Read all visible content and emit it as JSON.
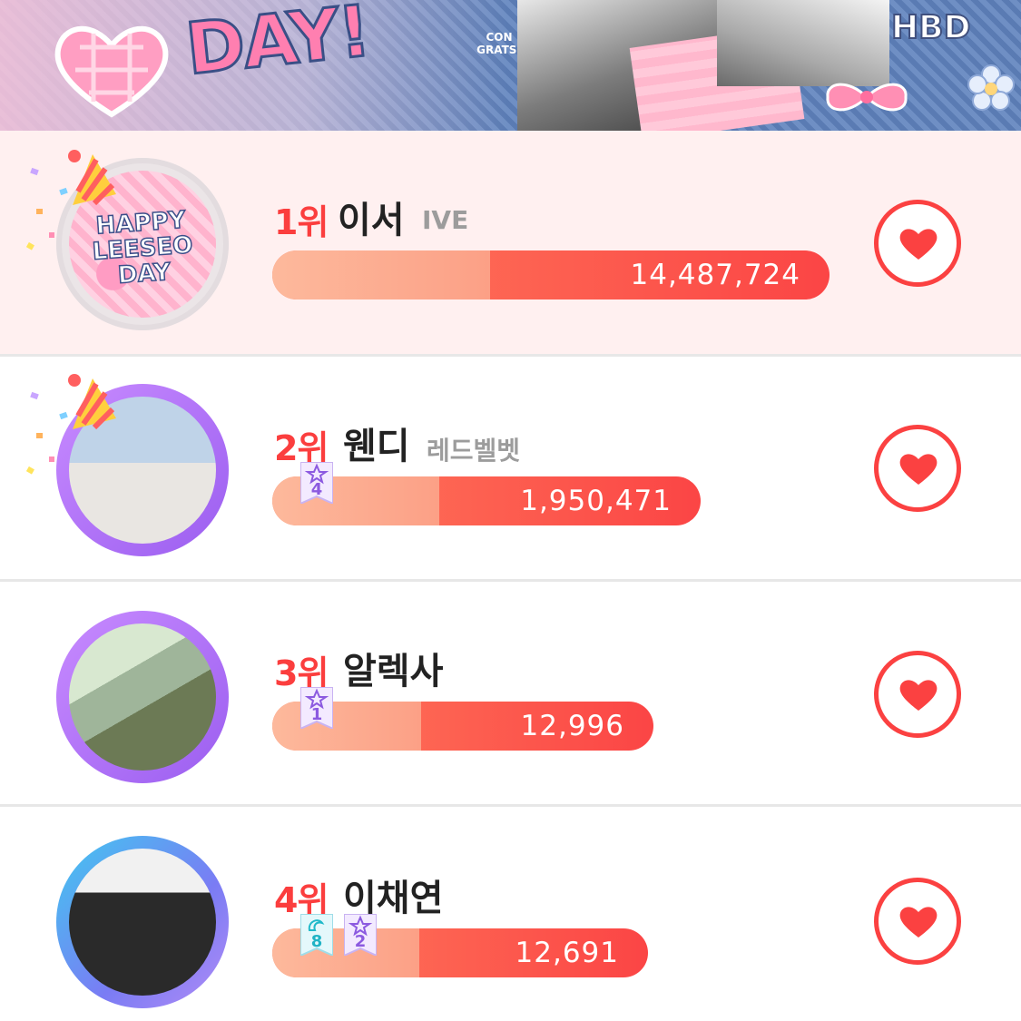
{
  "banner": {
    "day_text": "DAY!",
    "congrats_text": "CON GRATS!",
    "hbd_text": "HBD"
  },
  "rankings": [
    {
      "rank": "1위",
      "name": "이서",
      "group": "IVE",
      "votes": "14,487,724",
      "fill_fraction": 1.0,
      "badges": []
    },
    {
      "rank": "2위",
      "name": "웬디",
      "group": "레드벨벳",
      "votes": "1,950,471",
      "fill_fraction": 0.13,
      "badges": [
        {
          "type": "star",
          "count": "4"
        }
      ]
    },
    {
      "rank": "3위",
      "name": "알렉사",
      "group": "",
      "votes": "12,996",
      "fill_fraction": 0.001,
      "badges": [
        {
          "type": "star",
          "count": "1"
        }
      ]
    },
    {
      "rank": "4위",
      "name": "이채연",
      "group": "",
      "votes": "12,691",
      "fill_fraction": 0.001,
      "badges": [
        {
          "type": "angel",
          "count": "8"
        },
        {
          "type": "star",
          "count": "2"
        }
      ]
    }
  ],
  "avatar_1_art_text": "HAPPY LEESEO DAY",
  "colors": {
    "rank": "#fb3e3e",
    "bar_start": "#fdb99c",
    "bar_end": "#fb4545",
    "first_row_bg": "#fff0f0",
    "heart": "#fb4141"
  },
  "icons": {
    "vote": "heart-icon",
    "party": "party-hat-icon",
    "star_badge": "star-badge-icon",
    "angel_badge": "angel-badge-icon"
  }
}
